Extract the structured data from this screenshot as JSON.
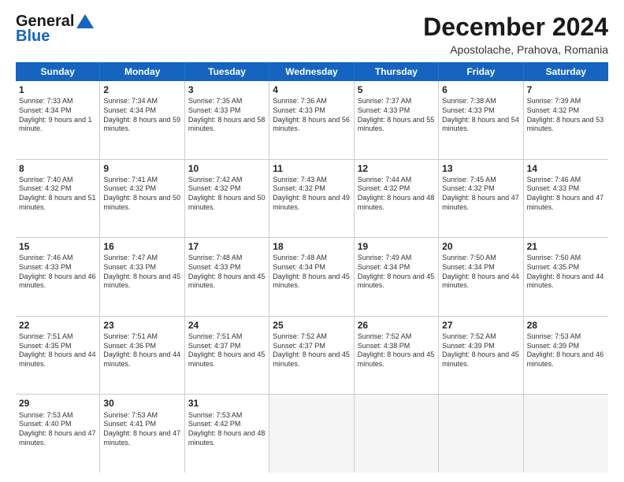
{
  "header": {
    "logo_general": "General",
    "logo_blue": "Blue",
    "title": "December 2024",
    "subtitle": "Apostolache, Prahova, Romania"
  },
  "weekdays": [
    "Sunday",
    "Monday",
    "Tuesday",
    "Wednesday",
    "Thursday",
    "Friday",
    "Saturday"
  ],
  "weeks": [
    [
      {
        "day": "1",
        "sunrise": "Sunrise: 7:33 AM",
        "sunset": "Sunset: 4:34 PM",
        "daylight": "Daylight: 9 hours and 1 minute."
      },
      {
        "day": "2",
        "sunrise": "Sunrise: 7:34 AM",
        "sunset": "Sunset: 4:34 PM",
        "daylight": "Daylight: 8 hours and 59 minutes."
      },
      {
        "day": "3",
        "sunrise": "Sunrise: 7:35 AM",
        "sunset": "Sunset: 4:33 PM",
        "daylight": "Daylight: 8 hours and 58 minutes."
      },
      {
        "day": "4",
        "sunrise": "Sunrise: 7:36 AM",
        "sunset": "Sunset: 4:33 PM",
        "daylight": "Daylight: 8 hours and 56 minutes."
      },
      {
        "day": "5",
        "sunrise": "Sunrise: 7:37 AM",
        "sunset": "Sunset: 4:33 PM",
        "daylight": "Daylight: 8 hours and 55 minutes."
      },
      {
        "day": "6",
        "sunrise": "Sunrise: 7:38 AM",
        "sunset": "Sunset: 4:33 PM",
        "daylight": "Daylight: 8 hours and 54 minutes."
      },
      {
        "day": "7",
        "sunrise": "Sunrise: 7:39 AM",
        "sunset": "Sunset: 4:32 PM",
        "daylight": "Daylight: 8 hours and 53 minutes."
      }
    ],
    [
      {
        "day": "8",
        "sunrise": "Sunrise: 7:40 AM",
        "sunset": "Sunset: 4:32 PM",
        "daylight": "Daylight: 8 hours and 51 minutes."
      },
      {
        "day": "9",
        "sunrise": "Sunrise: 7:41 AM",
        "sunset": "Sunset: 4:32 PM",
        "daylight": "Daylight: 8 hours and 50 minutes."
      },
      {
        "day": "10",
        "sunrise": "Sunrise: 7:42 AM",
        "sunset": "Sunset: 4:32 PM",
        "daylight": "Daylight: 8 hours and 50 minutes."
      },
      {
        "day": "11",
        "sunrise": "Sunrise: 7:43 AM",
        "sunset": "Sunset: 4:32 PM",
        "daylight": "Daylight: 8 hours and 49 minutes."
      },
      {
        "day": "12",
        "sunrise": "Sunrise: 7:44 AM",
        "sunset": "Sunset: 4:32 PM",
        "daylight": "Daylight: 8 hours and 48 minutes."
      },
      {
        "day": "13",
        "sunrise": "Sunrise: 7:45 AM",
        "sunset": "Sunset: 4:32 PM",
        "daylight": "Daylight: 8 hours and 47 minutes."
      },
      {
        "day": "14",
        "sunrise": "Sunrise: 7:46 AM",
        "sunset": "Sunset: 4:33 PM",
        "daylight": "Daylight: 8 hours and 47 minutes."
      }
    ],
    [
      {
        "day": "15",
        "sunrise": "Sunrise: 7:46 AM",
        "sunset": "Sunset: 4:33 PM",
        "daylight": "Daylight: 8 hours and 46 minutes."
      },
      {
        "day": "16",
        "sunrise": "Sunrise: 7:47 AM",
        "sunset": "Sunset: 4:33 PM",
        "daylight": "Daylight: 8 hours and 45 minutes."
      },
      {
        "day": "17",
        "sunrise": "Sunrise: 7:48 AM",
        "sunset": "Sunset: 4:33 PM",
        "daylight": "Daylight: 8 hours and 45 minutes."
      },
      {
        "day": "18",
        "sunrise": "Sunrise: 7:48 AM",
        "sunset": "Sunset: 4:34 PM",
        "daylight": "Daylight: 8 hours and 45 minutes."
      },
      {
        "day": "19",
        "sunrise": "Sunrise: 7:49 AM",
        "sunset": "Sunset: 4:34 PM",
        "daylight": "Daylight: 8 hours and 45 minutes."
      },
      {
        "day": "20",
        "sunrise": "Sunrise: 7:50 AM",
        "sunset": "Sunset: 4:34 PM",
        "daylight": "Daylight: 8 hours and 44 minutes."
      },
      {
        "day": "21",
        "sunrise": "Sunrise: 7:50 AM",
        "sunset": "Sunset: 4:35 PM",
        "daylight": "Daylight: 8 hours and 44 minutes."
      }
    ],
    [
      {
        "day": "22",
        "sunrise": "Sunrise: 7:51 AM",
        "sunset": "Sunset: 4:35 PM",
        "daylight": "Daylight: 8 hours and 44 minutes."
      },
      {
        "day": "23",
        "sunrise": "Sunrise: 7:51 AM",
        "sunset": "Sunset: 4:36 PM",
        "daylight": "Daylight: 8 hours and 44 minutes."
      },
      {
        "day": "24",
        "sunrise": "Sunrise: 7:51 AM",
        "sunset": "Sunset: 4:37 PM",
        "daylight": "Daylight: 8 hours and 45 minutes."
      },
      {
        "day": "25",
        "sunrise": "Sunrise: 7:52 AM",
        "sunset": "Sunset: 4:37 PM",
        "daylight": "Daylight: 8 hours and 45 minutes."
      },
      {
        "day": "26",
        "sunrise": "Sunrise: 7:52 AM",
        "sunset": "Sunset: 4:38 PM",
        "daylight": "Daylight: 8 hours and 45 minutes."
      },
      {
        "day": "27",
        "sunrise": "Sunrise: 7:52 AM",
        "sunset": "Sunset: 4:39 PM",
        "daylight": "Daylight: 8 hours and 45 minutes."
      },
      {
        "day": "28",
        "sunrise": "Sunrise: 7:53 AM",
        "sunset": "Sunset: 4:39 PM",
        "daylight": "Daylight: 8 hours and 46 minutes."
      }
    ],
    [
      {
        "day": "29",
        "sunrise": "Sunrise: 7:53 AM",
        "sunset": "Sunset: 4:40 PM",
        "daylight": "Daylight: 8 hours and 47 minutes."
      },
      {
        "day": "30",
        "sunrise": "Sunrise: 7:53 AM",
        "sunset": "Sunset: 4:41 PM",
        "daylight": "Daylight: 8 hours and 47 minutes."
      },
      {
        "day": "31",
        "sunrise": "Sunrise: 7:53 AM",
        "sunset": "Sunset: 4:42 PM",
        "daylight": "Daylight: 8 hours and 48 minutes."
      },
      {
        "day": "",
        "sunrise": "",
        "sunset": "",
        "daylight": ""
      },
      {
        "day": "",
        "sunrise": "",
        "sunset": "",
        "daylight": ""
      },
      {
        "day": "",
        "sunrise": "",
        "sunset": "",
        "daylight": ""
      },
      {
        "day": "",
        "sunrise": "",
        "sunset": "",
        "daylight": ""
      }
    ]
  ]
}
